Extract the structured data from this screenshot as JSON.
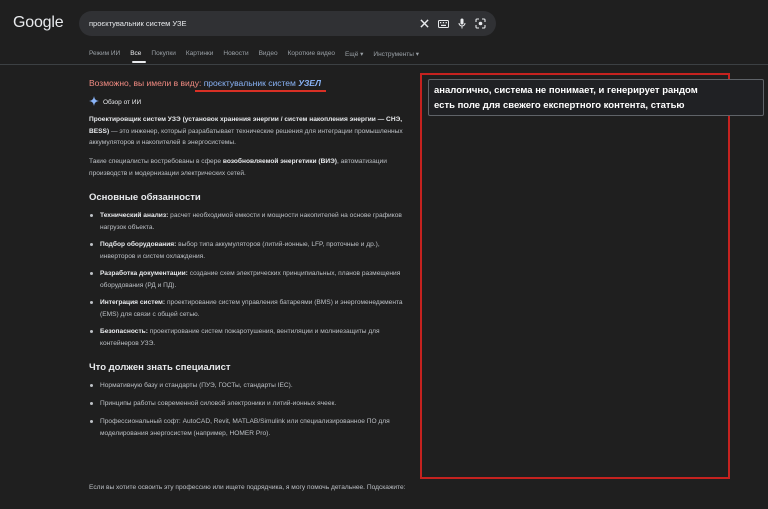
{
  "header": {
    "logo": "Google",
    "search_query": "проєктувальник систем УЗЕ"
  },
  "tabs": [
    {
      "label": "Режим ИИ"
    },
    {
      "label": "Все"
    },
    {
      "label": "Покупки"
    },
    {
      "label": "Картинки"
    },
    {
      "label": "Новости"
    },
    {
      "label": "Видео"
    },
    {
      "label": "Короткие видео"
    },
    {
      "label": "Ещё ▾"
    },
    {
      "label": "Инструменты ▾"
    }
  ],
  "did_you_mean": {
    "prefix": "Возможно, вы имели в виду:",
    "link_plain": "проєктувальник систем",
    "link_bold": "УЗЕЛ"
  },
  "ai_overview": {
    "label": "Обзор от ИИ"
  },
  "content": {
    "intro_bold": "Проектировщик систем УЗЭ (установок хранения энергии / систем накопления энергии — СНЭ, BESS)",
    "intro_rest": " — это инженер, который разрабатывает технические решения для интеграции промышленных аккумуляторов и накопителей в энергосистемы.",
    "para2_a": "Такие специалисты востребованы в сфере ",
    "para2_bold": "возобновляемой энергетики (ВИЭ)",
    "para2_b": ", автоматизации производств и модернизации электрических сетей.",
    "h_duties": "Основные обязанности",
    "duties": [
      {
        "bold": "Технический анализ:",
        "text": " расчет необходимой емкости и мощности накопителей на основе графиков нагрузок объекта."
      },
      {
        "bold": "Подбор оборудования:",
        "text": " выбор типа аккумуляторов (литий-ионные, LFP, проточные и др.), инверторов и систем охлаждения."
      },
      {
        "bold": "Разработка документации:",
        "text": " создание схем электрических принципиальных, планов размещения оборудования (РД и ПД)."
      },
      {
        "bold": "Интеграция систем:",
        "text": " проектирование систем управления батареями (BMS) и энергоменеджмента (EMS) для связи с общей сетью."
      },
      {
        "bold": "Безопасность:",
        "text": " проектирование систем пожаротушения, вентиляции и молниезащиты для контейнеров УЗЭ."
      }
    ],
    "h_know": "Что должен знать специалист",
    "know": [
      {
        "text": "Нормативную базу и стандарты (ПУЭ, ГОСТы, стандарты IEC)."
      },
      {
        "text": "Принципы работы современной силовой электроники и литий-ионных ячеек."
      },
      {
        "text": "Профессиональный софт: AutoCAD, Revit, MATLAB/Simulink или специализированное ПО для моделирования энергосистем (например, HOMER Pro)."
      }
    ],
    "footer": "Если вы хотите освоить эту профессию или ищете подрядчика, я могу помочь детальнее. Подскажите:"
  },
  "annotation": {
    "line1": "аналогично, система не понимает, и генерирует рандом",
    "line2": "есть поле для свежего експертного контента, статью",
    "box_color": "#c5221f"
  }
}
